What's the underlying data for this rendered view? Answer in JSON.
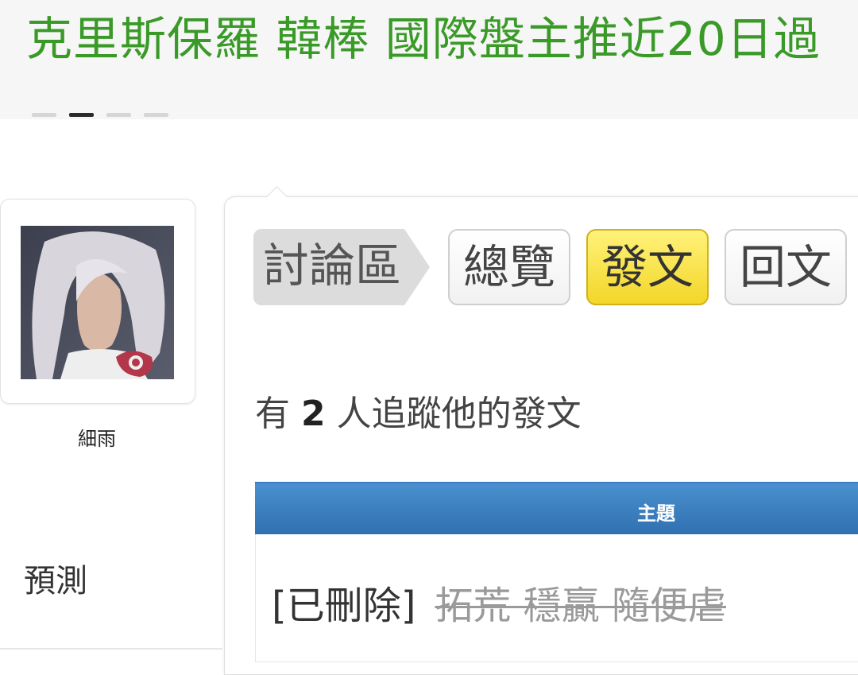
{
  "banner": {
    "title": "克里斯保羅 韓棒 國際盤主推近20日過",
    "carousel": {
      "dot_count": 4,
      "active_index": 1
    }
  },
  "profile": {
    "username": "細雨",
    "side_link": "預測"
  },
  "tabs": {
    "breadcrumb": "討論區",
    "overview": "總覽",
    "post": "發文",
    "reply": "回文"
  },
  "followers": {
    "prefix": "有",
    "count": "2",
    "suffix": "人追蹤他的發文"
  },
  "table": {
    "header": "主題",
    "rows": [
      {
        "tag": "[已刪除]",
        "title": "拓荒 穩贏 隨便虐"
      }
    ]
  },
  "colors": {
    "banner_title": "#3a9a28",
    "active_tab": "#f3d628",
    "table_header": "#2f6fb0"
  }
}
